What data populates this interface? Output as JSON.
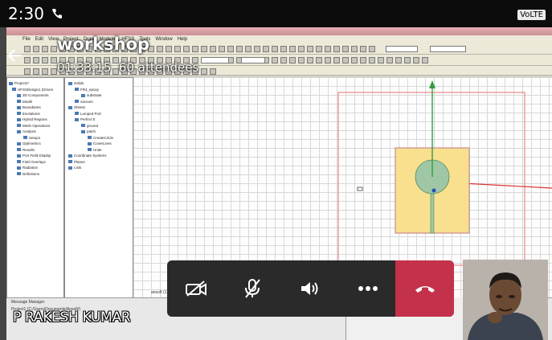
{
  "status_bar": {
    "time": "2:30",
    "network_badge": "VoLTE"
  },
  "meeting": {
    "title": "workshop",
    "elapsed": "01:33:15",
    "attendees": "60 attendees",
    "presenter_name": "P RAKESH KUMAR"
  },
  "shared_screen": {
    "menu_items": [
      "File",
      "Edit",
      "View",
      "Project",
      "Draw",
      "Modeler",
      "HFSS",
      "Tools",
      "Window",
      "Help"
    ],
    "tree_left": [
      "Project1*",
      "HFSSDesign1 (Driven",
      "3D Components",
      "Model",
      "Boundaries",
      "Excitations",
      "Hybrid Regions",
      "Mesh Operations",
      "Analysis",
      "Setup1",
      "Optimetrics",
      "Results",
      "Port Field Display",
      "Field Overlays",
      "Radiation",
      "Definitions"
    ],
    "tree_mid": [
      "Solids",
      "FR4_epoxy",
      "substrate",
      "vacuum",
      "Sheets",
      "Lumped Port",
      "Perfect E",
      "ground",
      "patch",
      "CreateCircle",
      "CoverLines",
      "Unite",
      "Coordinate Systems",
      "Planes",
      "Lists"
    ],
    "message_manager_label": "Message Manager",
    "message_line": "Project1 (C:/Users/Documents/Ansoft/)",
    "message_tail": "ansoft (12:08:12 PM May 09, 2023)"
  },
  "colors": {
    "end_call": "#c4314b",
    "control_bar": "#2a2a2a",
    "axis_green": "#2e9e3c",
    "axis_red": "#d33",
    "substrate_fill": "#f8e08e",
    "patch_fill": "#9fc7a6"
  }
}
